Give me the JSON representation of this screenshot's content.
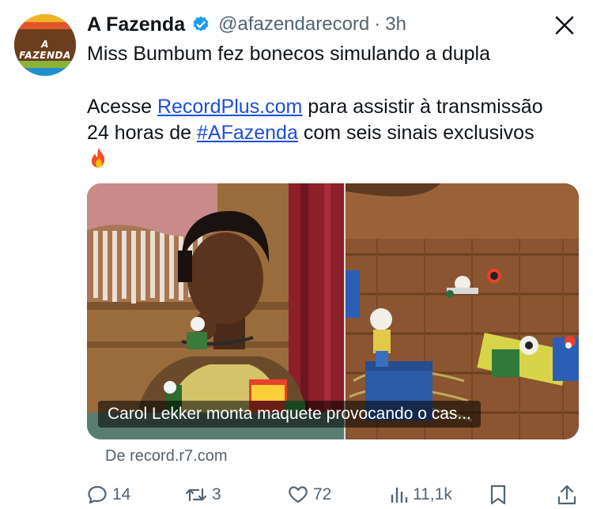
{
  "tweet": {
    "display_name": "A Fazenda",
    "handle": "@afazendarecord",
    "separator": "·",
    "time": "3h",
    "text_line1": "Miss Bumbum fez bonecos simulando a dupla",
    "text_line2_prefix": "Acesse ",
    "text_line2_link": "RecordPlus.com",
    "text_line2_suffix": " para assistir à transmissão",
    "text_line3_prefix": "24 horas de ",
    "text_line3_hashtag": "#AFazenda",
    "text_line3_suffix": " com seis sinais exclusivos"
  },
  "avatar": {
    "logo_text": "A FAZENDA",
    "colors": [
      "#f0b323",
      "#e2562b",
      "#6b3f1d",
      "#8bb339",
      "#1f8fce"
    ]
  },
  "media": {
    "caption": "Carol Lekker monta maquete provocando o cas...",
    "left_icon": "person-with-dolls-image",
    "right_icon": "dolls-on-table-image"
  },
  "link_card": {
    "source": "De record.r7.com"
  },
  "actions": {
    "replies": "14",
    "retweets": "3",
    "likes": "72",
    "views": "11,1k"
  },
  "colors": {
    "text": "#0f1419",
    "muted": "#536471",
    "link": "#1d4ed8",
    "verified": "#1d9bf0"
  }
}
